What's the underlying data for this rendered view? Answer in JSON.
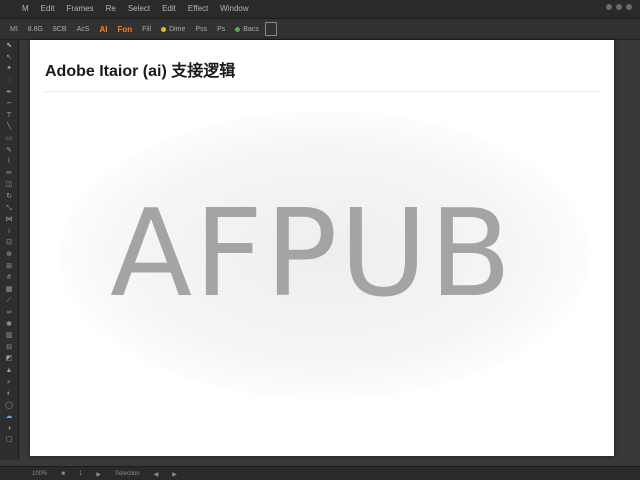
{
  "menubar": {
    "items": [
      "M",
      "Edit",
      "Frames",
      "Re",
      "Select",
      "Edit",
      "Effect",
      "Window"
    ]
  },
  "controlbar": {
    "items": [
      "MI",
      "8.8G",
      "8CB",
      "AcS",
      "AI",
      "Fon",
      "Fill",
      "Dime",
      "Pss",
      "Ps",
      "Bacs"
    ],
    "accent_color": "#ff7a1a"
  },
  "toolbar": {
    "tools": [
      {
        "name": "selection-tool-icon",
        "glyph": "⬉"
      },
      {
        "name": "direct-selection-tool-icon",
        "glyph": "↖"
      },
      {
        "name": "magic-wand-tool-icon",
        "glyph": "✦"
      },
      {
        "name": "lasso-tool-icon",
        "glyph": "◌"
      },
      {
        "name": "pen-tool-icon",
        "glyph": "✒"
      },
      {
        "name": "curvature-tool-icon",
        "glyph": "∽"
      },
      {
        "name": "type-tool-icon",
        "glyph": "T"
      },
      {
        "name": "line-tool-icon",
        "glyph": "╲"
      },
      {
        "name": "rectangle-tool-icon",
        "glyph": "▭"
      },
      {
        "name": "paintbrush-tool-icon",
        "glyph": "✎"
      },
      {
        "name": "shaper-tool-icon",
        "glyph": "⌇"
      },
      {
        "name": "pencil-tool-icon",
        "glyph": "✏"
      },
      {
        "name": "eraser-tool-icon",
        "glyph": "◫"
      },
      {
        "name": "rotate-tool-icon",
        "glyph": "↻"
      },
      {
        "name": "scale-tool-icon",
        "glyph": "⤡"
      },
      {
        "name": "width-tool-icon",
        "glyph": "⋈"
      },
      {
        "name": "warp-tool-icon",
        "glyph": "≀"
      },
      {
        "name": "free-transform-tool-icon",
        "glyph": "⊡"
      },
      {
        "name": "shape-builder-tool-icon",
        "glyph": "⊕"
      },
      {
        "name": "perspective-grid-tool-icon",
        "glyph": "⊞"
      },
      {
        "name": "mesh-tool-icon",
        "glyph": "#"
      },
      {
        "name": "gradient-tool-icon",
        "glyph": "▦"
      },
      {
        "name": "eyedropper-tool-icon",
        "glyph": "⟋"
      },
      {
        "name": "blend-tool-icon",
        "glyph": "∞"
      },
      {
        "name": "symbol-sprayer-tool-icon",
        "glyph": "✱"
      },
      {
        "name": "column-graph-tool-icon",
        "glyph": "▥"
      },
      {
        "name": "artboard-tool-icon",
        "glyph": "⊟"
      },
      {
        "name": "slice-tool-icon",
        "glyph": "◩"
      },
      {
        "name": "hand-tool-icon",
        "glyph": "▲"
      },
      {
        "name": "zoom-tool-icon",
        "glyph": "⌕"
      },
      {
        "name": "fill-swatch-icon",
        "glyph": "◐"
      },
      {
        "name": "stroke-swatch-icon",
        "glyph": "◯"
      },
      {
        "name": "cloud-tool-icon",
        "glyph": "☁"
      },
      {
        "name": "color-mode-icon",
        "glyph": "◑"
      },
      {
        "name": "screen-mode-icon",
        "glyph": "▢"
      }
    ],
    "active_index": 32
  },
  "document": {
    "title": "Adobe Itaior (ai) 支接逻辑",
    "artwork_text": "AFPUB"
  },
  "statusbar": {
    "items": [
      "100%",
      "■",
      "1",
      "▶",
      "Selection",
      "◀",
      "▶"
    ]
  }
}
